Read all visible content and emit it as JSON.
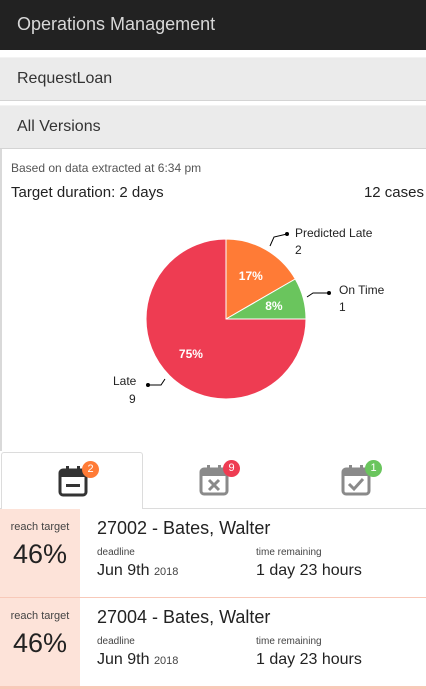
{
  "app": {
    "title": "Operations Management"
  },
  "selectors": [
    {
      "label": "RequestLoan"
    },
    {
      "label": "All Versions"
    }
  ],
  "summary": {
    "extracted": "Based on data extracted at 6:34 pm",
    "target": "Target duration: 2 days",
    "cases": "12 cases"
  },
  "chart_data": {
    "type": "pie",
    "slices": [
      {
        "name": "Late",
        "value": 9,
        "percent_label": "75%",
        "color": "#ee3c52"
      },
      {
        "name": "Predicted Late",
        "value": 2,
        "percent_label": "17%",
        "color": "#ff7b36"
      },
      {
        "name": "On Time",
        "value": 1,
        "percent_label": "8%",
        "color": "#6ac55d"
      }
    ]
  },
  "tabs": [
    {
      "icon": "calendar-minus-icon",
      "count": "2",
      "badge_color": "#ff7b36",
      "active": true
    },
    {
      "icon": "calendar-x-icon",
      "count": "9",
      "badge_color": "#ee3c52",
      "active": false
    },
    {
      "icon": "calendar-check-icon",
      "count": "1",
      "badge_color": "#6ac55d",
      "active": false
    }
  ],
  "cases": [
    {
      "reach_label": "reach target",
      "reach_value": "46%",
      "name": "27002 - Bates, Walter",
      "deadline_label": "deadline",
      "deadline_date": "Jun 9th",
      "deadline_year": "2018",
      "remaining_label": "time remaining",
      "remaining_value": "1 day 23 hours"
    },
    {
      "reach_label": "reach target",
      "reach_value": "46%",
      "name": "27004 - Bates, Walter",
      "deadline_label": "deadline",
      "deadline_date": "Jun 9th",
      "deadline_year": "2018",
      "remaining_label": "time remaining",
      "remaining_value": "1 day 23 hours"
    }
  ]
}
